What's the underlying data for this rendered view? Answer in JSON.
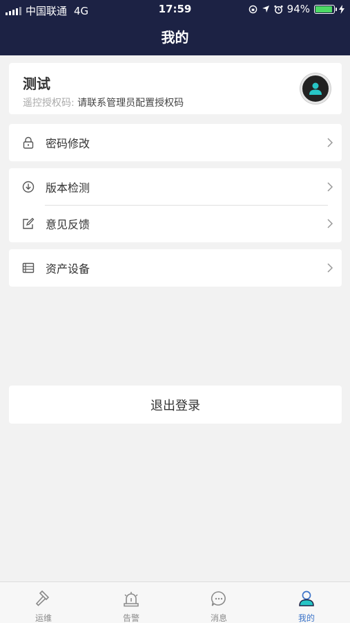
{
  "status_bar": {
    "carrier": "中国联通",
    "network": "4G",
    "time": "17:59",
    "battery": "94%"
  },
  "header": {
    "title": "我的"
  },
  "profile": {
    "name": "测试",
    "auth_label": "遥控授权码:",
    "auth_value": "请联系管理员配置授权码"
  },
  "menu": {
    "password": "密码修改",
    "version": "版本检测",
    "feedback": "意见反馈",
    "assets": "资产设备"
  },
  "logout_label": "退出登录",
  "tabs": [
    {
      "label": "运维",
      "icon": "hammer-icon"
    },
    {
      "label": "告警",
      "icon": "alarm-light-icon"
    },
    {
      "label": "消息",
      "icon": "message-icon"
    },
    {
      "label": "我的",
      "icon": "user-icon"
    }
  ],
  "colors": {
    "header_bg": "#1c2244",
    "active_tab": "#3b73c8",
    "avatar_accent": "#27c5c5"
  }
}
